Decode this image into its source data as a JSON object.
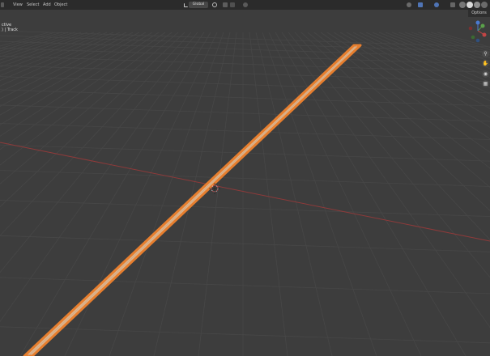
{
  "header": {
    "menu": [
      "View",
      "Select",
      "Add",
      "Object"
    ],
    "orientation": "Global",
    "options_label": "Options"
  },
  "overlay": {
    "line1": "ctive",
    "line2": ") | Track"
  },
  "colors": {
    "viewport_bg": "#3d3d3d",
    "grid": "#484848",
    "x_axis": "#9a3a3a",
    "mesh_fill": "#dcb48e",
    "mesh_outline": "#e67e2e"
  },
  "icons": [
    "editor-type-icon",
    "transform-orientation-icon",
    "snap-icon",
    "proportional-edit-icon",
    "overlay-icon",
    "xray-icon",
    "solid-shading-icon",
    "zoom-icon",
    "hand-icon",
    "camera-icon",
    "grid-icon"
  ]
}
